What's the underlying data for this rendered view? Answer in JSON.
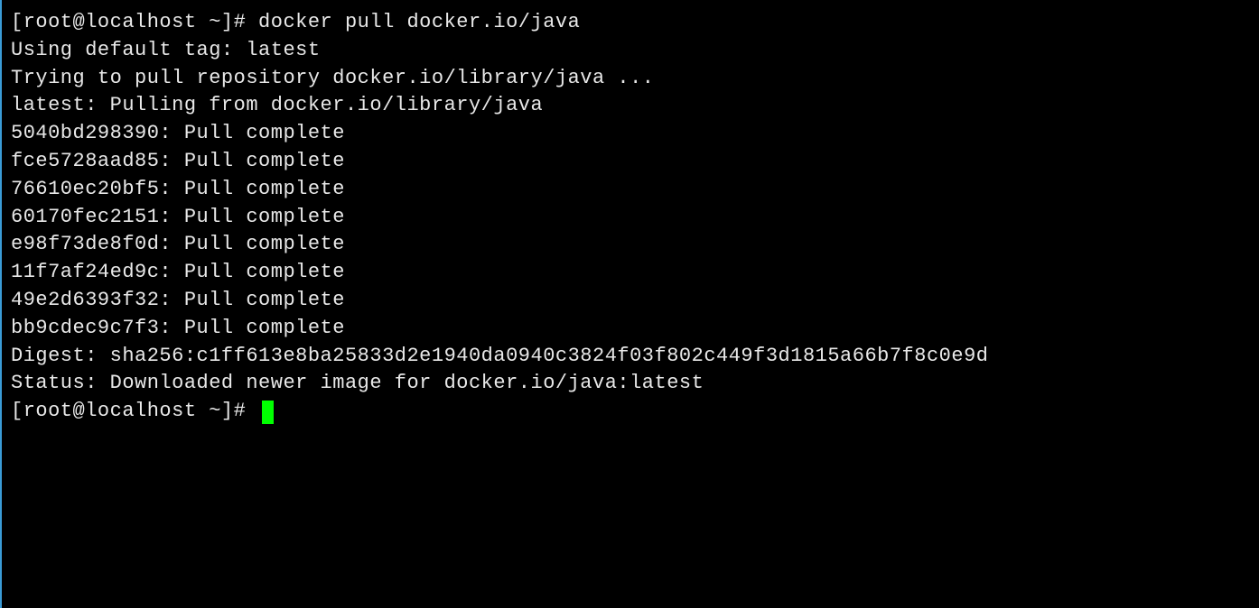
{
  "terminal": {
    "lines": [
      "[root@localhost ~]# docker pull docker.io/java",
      "Using default tag: latest",
      "Trying to pull repository docker.io/library/java ...",
      "latest: Pulling from docker.io/library/java",
      "5040bd298390: Pull complete",
      "fce5728aad85: Pull complete",
      "76610ec20bf5: Pull complete",
      "60170fec2151: Pull complete",
      "e98f73de8f0d: Pull complete",
      "11f7af24ed9c: Pull complete",
      "49e2d6393f32: Pull complete",
      "bb9cdec9c7f3: Pull complete",
      "Digest: sha256:c1ff613e8ba25833d2e1940da0940c3824f03f802c449f3d1815a66b7f8c0e9d",
      "Status: Downloaded newer image for docker.io/java:latest"
    ],
    "prompt": "[root@localhost ~]# "
  }
}
